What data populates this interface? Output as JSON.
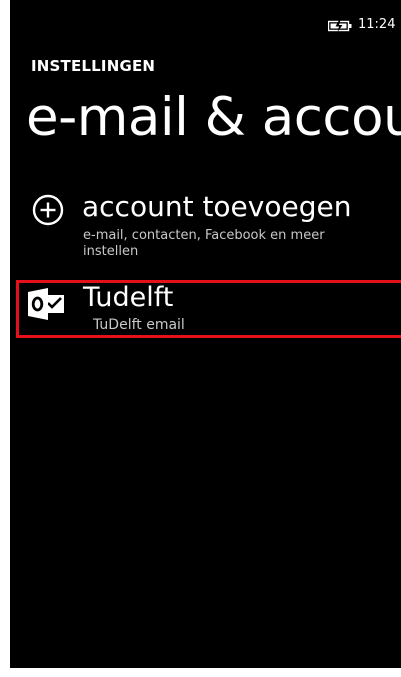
{
  "status_bar": {
    "time": "11:24",
    "battery_icon": "battery-charging-icon"
  },
  "header": {
    "app_title": "INSTELLINGEN",
    "page_title": "e-mail & accounts"
  },
  "add_account": {
    "icon": "plus-circle-icon",
    "label": "account toevoegen",
    "description": "e-mail, contacten, Facebook en meer instellen"
  },
  "accounts": [
    {
      "icon": "outlook-icon",
      "name": "Tudelft",
      "description": "TuDelft email"
    }
  ],
  "colors": {
    "background": "#000000",
    "text": "#ffffff",
    "secondary_text": "#c8c8c8",
    "highlight_border": "#e5101c"
  }
}
